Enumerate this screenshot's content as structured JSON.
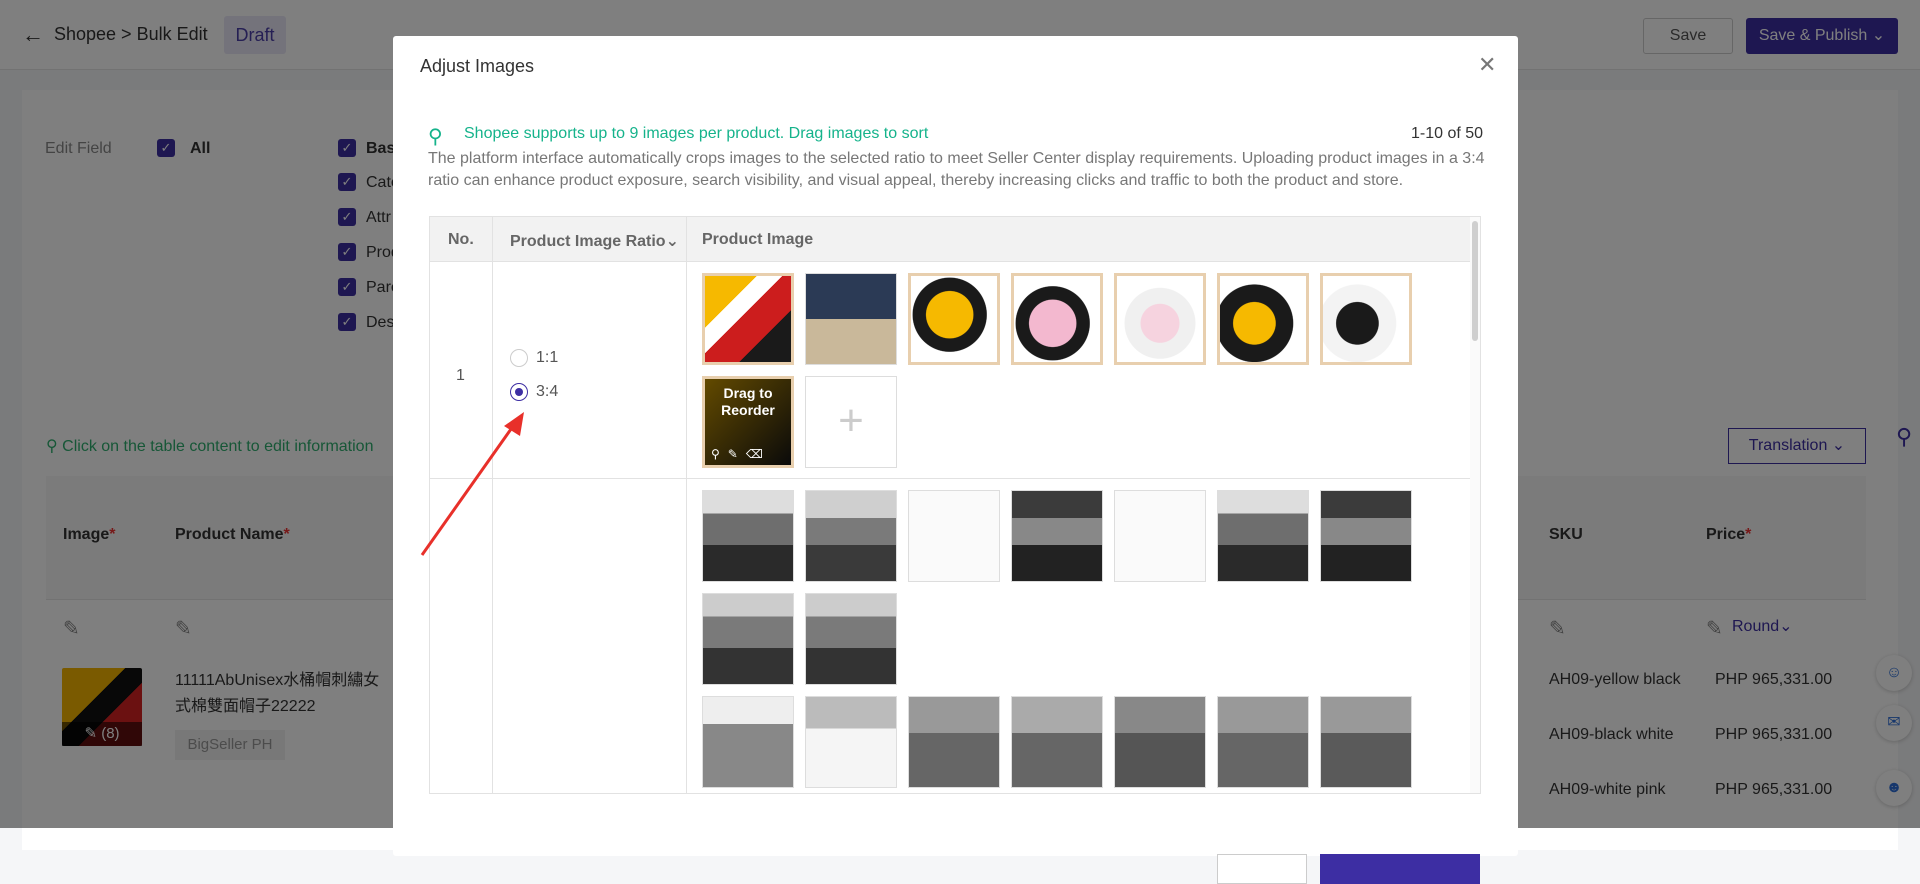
{
  "header": {
    "breadcrumb": "Shopee > Bulk Edit",
    "status_badge": "Draft",
    "save_label": "Save",
    "publish_label": "Save & Publish"
  },
  "edit_fields": {
    "label": "Edit Field",
    "all_label": "All",
    "fields": [
      "Bas",
      "Cate",
      "Attr",
      "Prod",
      "Pare",
      "Desc"
    ]
  },
  "page": {
    "hint": "Click on the table content to edit information",
    "translation_label": "Translation",
    "columns": {
      "image": "Image",
      "product_name": "Product Name",
      "sku": "SKU",
      "price": "Price"
    },
    "round_label": "Round",
    "image_badge": "(8)",
    "product_name": "11111AbUnisex水桶帽刺繡女式棉雙面帽子22222",
    "store_tag": "BigSeller PH",
    "rows": [
      {
        "sku": "AH09-yellow black",
        "price": "PHP 965,331.00"
      },
      {
        "sku": "AH09-black white",
        "price": "PHP 965,331.00"
      },
      {
        "sku": "AH09-white pink",
        "price": "PHP 965,331.00"
      }
    ]
  },
  "modal": {
    "title": "Adjust Images",
    "tip": "Shopee supports up to 9 images per product. Drag images to sort",
    "pager": "1-10 of 50",
    "description": "The platform interface automatically crops images to the selected ratio to meet Seller Center display requirements. Uploading product images in a 3:4 ratio can enhance product exposure, search visibility, and visual appeal, thereby increasing clicks and traffic to both the product and store.",
    "columns": {
      "no": "No.",
      "ratio": "Product Image Ratio",
      "image": "Product Image"
    },
    "row1": {
      "no": "1",
      "ratio_options": [
        "1:1",
        "3:4"
      ],
      "selected_ratio": "3:4",
      "drag_label": "Drag to Reorder"
    }
  },
  "colors": {
    "accent": "#3d2ea3",
    "tip_green": "#15b38b",
    "hint_green": "#2eae6f",
    "annotation_red": "#e8302a"
  }
}
